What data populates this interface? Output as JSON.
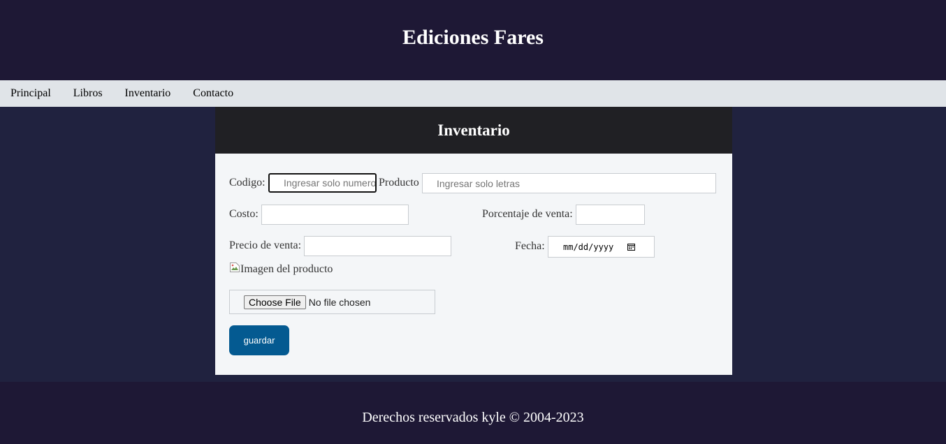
{
  "header": {
    "title": "Ediciones Fares"
  },
  "nav": {
    "items": [
      {
        "label": "Principal"
      },
      {
        "label": "Libros"
      },
      {
        "label": "Inventario"
      },
      {
        "label": "Contacto"
      }
    ]
  },
  "panel": {
    "title": "Inventario"
  },
  "form": {
    "codigo": {
      "label": "Codigo:",
      "placeholder": "Ingresar solo numeros",
      "value": ""
    },
    "producto": {
      "label": "Producto",
      "placeholder": "Ingresar solo letras",
      "value": ""
    },
    "costo": {
      "label": "Costo:",
      "value": ""
    },
    "porcentaje": {
      "label": "Porcentaje de venta:",
      "value": ""
    },
    "precio": {
      "label": "Precio de venta:",
      "value": ""
    },
    "fecha": {
      "label": "Fecha:",
      "value": "mm/dd/yyyy",
      "icon": "calendar-icon"
    },
    "imagen": {
      "alt": "Imagen del producto",
      "icon": "broken-image-icon"
    },
    "file": {
      "button_label": "Choose File",
      "status": "No file chosen"
    },
    "submit": {
      "label": "guardar",
      "color": "#045a91"
    }
  },
  "footer": {
    "text": "Derechos reservados kyle © 2004-2023"
  },
  "colors": {
    "header_bg": "#1e1835",
    "nav_bg": "#e0e4e8",
    "page_bg": "#20223f",
    "panel_head_bg": "#202024",
    "panel_bg": "#f4f6f8"
  }
}
